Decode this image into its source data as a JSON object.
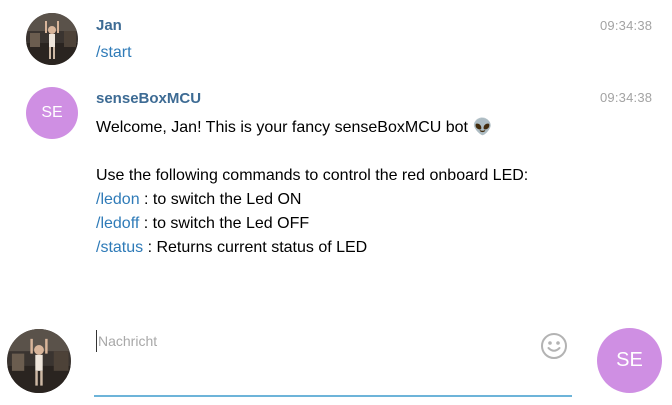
{
  "messages": [
    {
      "sender": "Jan",
      "time": "09:34:38",
      "text": "/start"
    },
    {
      "sender": "senseBoxMCU",
      "avatar_initials": "SE",
      "time": "09:34:38",
      "lines": {
        "welcome": "Welcome, Jan! This is your fancy senseBoxMCU bot 👽",
        "intro": "Use the following commands to control the red onboard LED:",
        "commands": [
          {
            "cmd": "/ledon",
            "desc": " : to switch the Led ON"
          },
          {
            "cmd": "/ledoff",
            "desc": " : to switch the Led OFF"
          },
          {
            "cmd": "/status",
            "desc": " : Returns current status of LED"
          }
        ]
      }
    }
  ],
  "composer": {
    "placeholder": "Nachricht",
    "emoji_icon": "smiley-icon",
    "bot_avatar_initials": "SE"
  },
  "colors": {
    "sender_name": "#3d6b94",
    "command_link": "#2f7bb8",
    "timestamp": "#a3a3a3",
    "bot_avatar": "#cf8fe3",
    "composer_underline": "#6db4d9"
  }
}
